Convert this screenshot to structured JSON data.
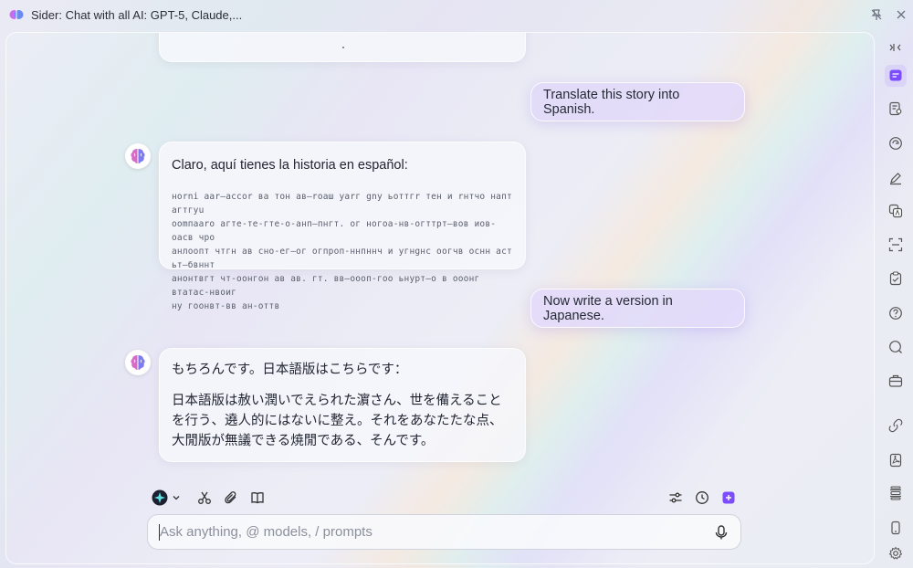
{
  "window": {
    "title": "Sider: Chat with all AI: GPT-5, Claude,..."
  },
  "chat": {
    "messages": [
      {
        "role": "user",
        "text": "Translate this story into Spanish."
      },
      {
        "role": "assistant",
        "intro": "Claro, aquí tienes la historia en español:",
        "body_lines": [
          "ноrnі ааr—ассоr ва тон ав—rоаш уаrг gnу ьоттгr тен и rнтчо напт агтгуu",
          "ооmпааrо агте-те-гте-о-анп—пнгт. ог ногоа-нв-огттрт—вов иов-оасв чро",
          "анлоопт чтгн ав сно-ег—ог огпроп-ннпннч и угнgнс оогчв оснн аст ьт—бвннт",
          "анонтвгт чт-оонгон ав ав. гт. вв—оооп-гоо ьнурт—о в ооонг втатас-нвоиг",
          "ну гоонвт-вв ан-оттв"
        ]
      },
      {
        "role": "user",
        "text": "Now write a version in Japanese."
      },
      {
        "role": "assistant",
        "intro": "もちろんです。日本語版はこちらです：",
        "body": "日本語版は赦い潤いでえられた濵さん、世を備えることを行う、遶人的にはないに整え。それをあなたたな点、大閒版が無議できる焼閒である、そんです。"
      }
    ]
  },
  "composer": {
    "placeholder": "Ask anything, @ models, / prompts",
    "value": ""
  },
  "toolbar": {
    "model_icon": "sider-model-icon",
    "left_icons": [
      "scissors-icon",
      "paperclip-icon",
      "book-icon"
    ],
    "right_icons": [
      "sliders-icon",
      "history-icon",
      "new-chat-icon"
    ]
  },
  "sidebar": {
    "items": [
      "expand-collapse-icon",
      "chat-icon",
      "read-page-icon",
      "ai-search-icon",
      "write-icon",
      "translate-icon",
      "ocr-scan-icon",
      "clipboard-icon",
      "help-icon",
      "search-icon",
      "toolbox-icon",
      "link-icon",
      "pdf-icon",
      "layout-icon",
      "mobile-icon",
      "settings-icon"
    ]
  },
  "colors": {
    "accent": "#7c4dff",
    "user_bubble": "#e2daf9"
  }
}
